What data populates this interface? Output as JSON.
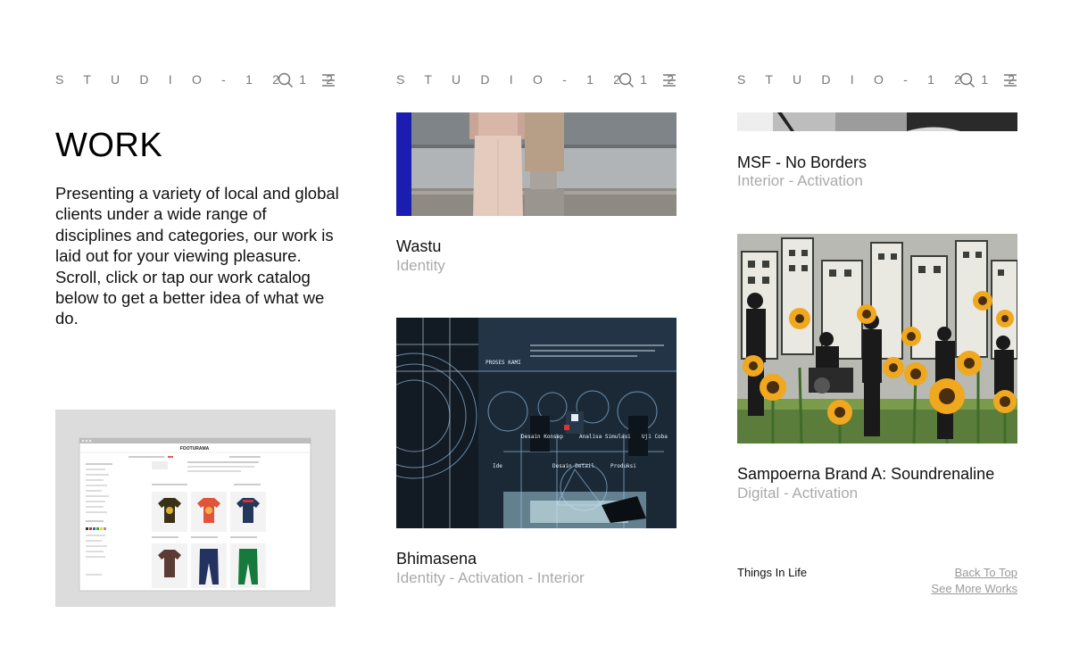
{
  "logo": "S T U D I O - 1 2 1 2",
  "intro": {
    "title": "WORK",
    "description": "Presenting a variety of local and global clients under a wide range of disciplines and categories, our work is laid out for your viewing pleasure. Scroll, click or tap our work catalog below to get a better idea of what we do."
  },
  "mockup": {
    "brand": "FOOTURAMA"
  },
  "projects": [
    {
      "title": "Wastu",
      "categories": "Identity"
    },
    {
      "title": "Bhimasena",
      "categories": "Identity - Activation - Interior"
    },
    {
      "title": "MSF - No Borders",
      "categories": "Interior - Activation"
    },
    {
      "title": "Sampoerna Brand A: Soundrenaline",
      "categories": "Digital - Activation"
    }
  ],
  "bhimasena_screen": {
    "heading": "PROSES KAMI",
    "labels": [
      "Desain Konsep",
      "Analisa Simulasi",
      "Uji Coba",
      "Ide",
      "Desain Detail",
      "Produksi"
    ]
  },
  "footer": {
    "things": "Things In Life",
    "back_to_top": "Back To Top",
    "see_more": "See More Works"
  },
  "colors": {
    "muted_text": "#aaaaaa",
    "logo_gray": "#777777",
    "link_gray": "#999999"
  }
}
